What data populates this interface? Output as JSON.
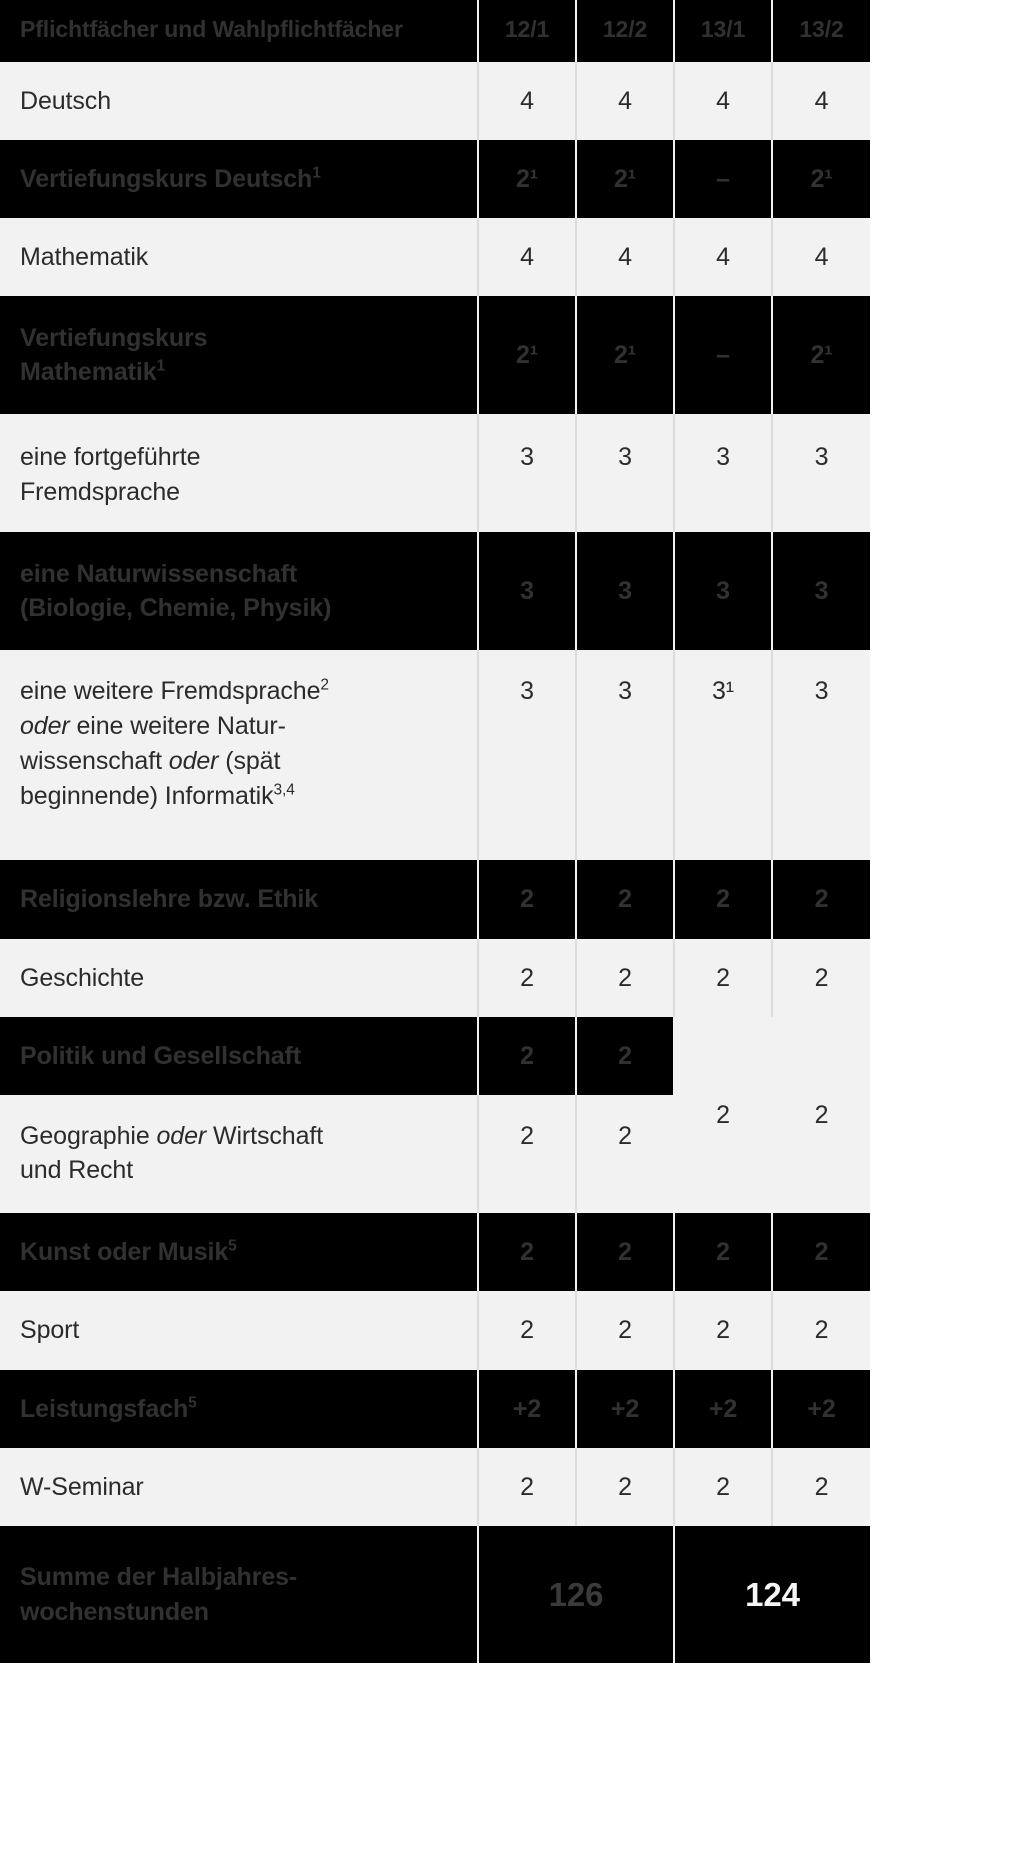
{
  "table": {
    "header": {
      "subject_label": "Pflichtfächer und Wahlpflichtfächer",
      "terms": [
        "12/1",
        "12/2",
        "13/1",
        "13/2"
      ]
    },
    "rows": [
      {
        "subject": "Deutsch",
        "values": [
          "4",
          "4",
          "4",
          "4"
        ]
      },
      {
        "subject": "Vertiefungskurs Deutsch",
        "sup": "1",
        "values": [
          "2¹",
          "2¹",
          "–",
          "2¹"
        ]
      },
      {
        "subject": "Mathematik",
        "values": [
          "4",
          "4",
          "4",
          "4"
        ]
      },
      {
        "subject": "Vertiefungskurs Mathematik",
        "sup": "1",
        "values": [
          "2¹",
          "2¹",
          "–",
          "2¹"
        ]
      },
      {
        "subject": "eine fortgeführte Fremdsprache",
        "values": [
          "3",
          "3",
          "3",
          "3"
        ]
      },
      {
        "subject": "eine Naturwissenschaft (Biologie, Chemie, Physik)",
        "values": [
          "3",
          "3",
          "3",
          "3"
        ]
      },
      {
        "subject": "eine weitere Fremdsprache² oder eine weitere Naturwissenschaft oder (spät beginnende) Informatik³,⁴",
        "values": [
          "3",
          "3",
          "3¹",
          "3"
        ]
      },
      {
        "subject": "Religionslehre bzw. Ethik",
        "values": [
          "2",
          "2",
          "2",
          "2"
        ]
      },
      {
        "subject": "Geschichte",
        "values": [
          "2",
          "2",
          "2",
          "2"
        ]
      },
      {
        "subject": "Politik und Gesellschaft",
        "values": [
          "2",
          "2"
        ]
      },
      {
        "subject": "Geographie oder Wirtschaft und Recht",
        "values": [
          "2",
          "2"
        ],
        "merged": [
          "2",
          "2"
        ]
      },
      {
        "subject": "Kunst oder Musik",
        "sup": "5",
        "values": [
          "2",
          "2",
          "2",
          "2"
        ]
      },
      {
        "subject": "Sport",
        "values": [
          "2",
          "2",
          "2",
          "2"
        ]
      },
      {
        "subject": "Leistungsfach",
        "sup": "5",
        "values": [
          "+2",
          "+2",
          "+2",
          "+2"
        ]
      },
      {
        "subject": "W-Seminar",
        "values": [
          "2",
          "2",
          "2",
          "2"
        ]
      }
    ],
    "summary": {
      "label_line1": "Summe der Halbjahres-",
      "label_line2": "wochenstunden",
      "value_left": "126",
      "value_right": "124"
    },
    "row_text_parts": {
      "r1_a": "Vertiefungskurs Deutsch",
      "r1_sup": "1",
      "r3_a": "Vertiefungskurs",
      "r3_b": "Mathematik",
      "r3_sup": "1",
      "r4_a": "eine fortgeführte",
      "r4_b": "Fremdsprache",
      "r5_a": "eine Naturwissenschaft",
      "r5_b": "(Biologie, Chemie, Physik)",
      "r6_a": "eine weitere Fremdsprache",
      "r6_sup_a": "2",
      "r6_oder1": "oder",
      "r6_b": " eine weitere Natur-",
      "r6_c": "wissenschaft ",
      "r6_oder2": "oder",
      "r6_d": " (spät",
      "r6_e": "beginnende) Informatik",
      "r6_sup_b": "3,4",
      "r10_a": "Geographie ",
      "r10_oder": "oder",
      "r10_b": " Wirtschaft",
      "r10_c": "und Recht",
      "r11_a": "Kunst oder Musik",
      "r11_sup": "5",
      "r13_a": "Leistungsfach",
      "r13_sup": "5"
    },
    "colors": {
      "light_row_bg": "#f2f2f2",
      "dark_row_bg": "#000000",
      "light_row_text": "#2b2b2b",
      "dark_row_text": "#313131",
      "divider": "#dcdcdc",
      "summary_highlight_text": "#f6f6f6"
    }
  }
}
